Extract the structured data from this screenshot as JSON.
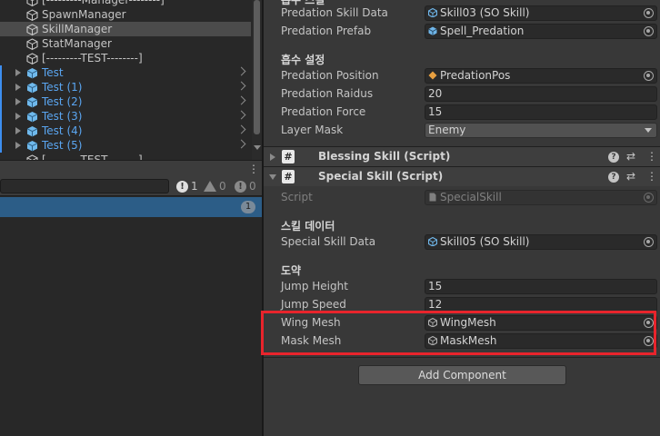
{
  "hierarchy": {
    "items": [
      {
        "label": "[---------Manager--------]",
        "blue": false,
        "foldout": false,
        "chevron": false,
        "selected": false
      },
      {
        "label": "SpawnManager",
        "blue": false,
        "foldout": false,
        "chevron": false,
        "selected": false
      },
      {
        "label": "SkillManager",
        "blue": false,
        "foldout": false,
        "chevron": false,
        "selected": true
      },
      {
        "label": "StatManager",
        "blue": false,
        "foldout": false,
        "chevron": false,
        "selected": false
      },
      {
        "label": "[---------TEST--------]",
        "blue": false,
        "foldout": false,
        "chevron": false,
        "selected": false
      },
      {
        "label": "Test",
        "blue": true,
        "foldout": true,
        "chevron": true,
        "selected": false
      },
      {
        "label": "Test (1)",
        "blue": true,
        "foldout": true,
        "chevron": true,
        "selected": false
      },
      {
        "label": "Test (2)",
        "blue": true,
        "foldout": true,
        "chevron": true,
        "selected": false
      },
      {
        "label": "Test (3)",
        "blue": true,
        "foldout": true,
        "chevron": true,
        "selected": false
      },
      {
        "label": "Test (4)",
        "blue": true,
        "foldout": true,
        "chevron": true,
        "selected": false
      },
      {
        "label": "Test (5)",
        "blue": true,
        "foldout": true,
        "chevron": true,
        "selected": false
      },
      {
        "label": "[---------TEST--------]",
        "blue": false,
        "foldout": false,
        "chevron": false,
        "selected": false
      }
    ]
  },
  "console": {
    "menu_glyph": "⋮",
    "error_count": "1",
    "warning_count": "0",
    "info_count": "0",
    "row_count": "1",
    "error_glyph": "!",
    "info_glyph": "!"
  },
  "inspector": {
    "top_section_partial": "흡수 스킬",
    "predation_skill_data": {
      "label": "Predation Skill Data",
      "value": "Skill03 (SO Skill)"
    },
    "predation_prefab": {
      "label": "Predation Prefab",
      "value": "Spell_Predation"
    },
    "absorb_section": "흡수 설정",
    "predation_position": {
      "label": "Predation Position",
      "value": "PredationPos"
    },
    "predation_radius": {
      "label": "Predation Raidus",
      "value": "20"
    },
    "predation_force": {
      "label": "Predation Force",
      "value": "15"
    },
    "layer_mask": {
      "label": "Layer Mask",
      "value": "Enemy"
    },
    "blessing_component": {
      "title": "Blessing Skill (Script)"
    },
    "special_component": {
      "title": "Special Skill (Script)"
    },
    "component_icons": {
      "hash": "#",
      "help": "?",
      "preset": "⇄",
      "menu": "⋮"
    },
    "script_field": {
      "label": "Script",
      "value": "SpecialSkill"
    },
    "skill_data_section": "스킬 데이터",
    "special_skill_data": {
      "label": "Special Skill Data",
      "value": "Skill05 (SO Skill)"
    },
    "jump_section": "도약",
    "jump_height": {
      "label": "Jump Height",
      "value": "15"
    },
    "jump_speed": {
      "label": "Jump Speed",
      "value": "12"
    },
    "wing_mesh": {
      "label": "Wing Mesh",
      "value": "WingMesh"
    },
    "mask_mesh": {
      "label": "Mask Mesh",
      "value": "MaskMesh"
    },
    "add_component": "Add Component"
  },
  "colors": {
    "highlight": "#e8242c",
    "hierarchy_blue": "#5aa5f0",
    "console_selected": "#2c5d87"
  }
}
